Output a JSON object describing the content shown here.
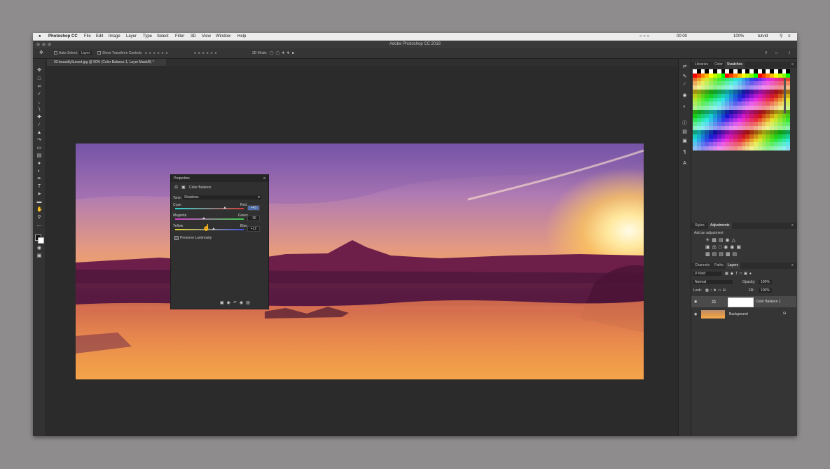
{
  "menubar": {
    "app": "Photoshop CC",
    "items": [
      "File",
      "Edit",
      "Image",
      "Layer",
      "Type",
      "Select",
      "Filter",
      "3D",
      "View",
      "Window",
      "Help"
    ],
    "status": {
      "clock": "00:00",
      "battery": "100%",
      "user": "tutvid"
    }
  },
  "window": {
    "title": "Adobe Photoshop CC 2018"
  },
  "options": {
    "auto_select": "Auto-Select:",
    "layer_select": "Layer",
    "transform": "Show Transform Controls",
    "mode3d": "3D Mode:"
  },
  "document": {
    "tab": "03-beautifySunset.jpg @ 50% (Color Balance 1, Layer Mask/8) *"
  },
  "properties": {
    "title": "Properties",
    "type_label": "Color Balance",
    "tone_label": "Tone:",
    "tone_value": "Shadows",
    "sliders": [
      {
        "left": "Cyan",
        "right": "Red",
        "value": "+43",
        "position": 0.72,
        "grad": "linear-gradient(90deg,#2fd6d6,#d83b3b)"
      },
      {
        "left": "Magenta",
        "right": "Green",
        "value": "-16",
        "position": 0.42,
        "grad": "linear-gradient(90deg,#d33fd0,#3fcf4c)"
      },
      {
        "left": "Yellow",
        "right": "Blue",
        "value": "+12",
        "position": 0.56,
        "grad": "linear-gradient(90deg,#e8d931,#3c52e6)"
      }
    ],
    "preserve": "Preserve Luminosity"
  },
  "panels": {
    "top_tabs": [
      "Libraries",
      "Color",
      "Swatches"
    ],
    "top_active": 2,
    "mid_tabs": [
      "Styles",
      "Adjustments"
    ],
    "mid_active": 1,
    "add_adjustment": "Add an adjustment",
    "bottom_tabs": [
      "Channels",
      "Paths",
      "Layers"
    ],
    "bottom_active": 2,
    "kind": "Kind",
    "blend_mode": "Normal",
    "opacity_label": "Opacity:",
    "opacity": "100%",
    "lock_label": "Lock:",
    "fill_label": "Fill:",
    "fill": "100%",
    "layers": [
      "Color Balance 1",
      "Background"
    ]
  },
  "swatch_colors": [
    "#ff0000",
    "#ff4000",
    "#ff8000",
    "#ffbf00",
    "#ffff00",
    "#c0ff00",
    "#80ff00",
    "#00ff00",
    "#00ff80",
    "#00ffff",
    "#0080ff",
    "#0000ff",
    "#8000ff",
    "#ff00ff",
    "#ff0080",
    "#ff6666",
    "#ffb366",
    "#ffff66",
    "#66ff66",
    "#66ffff",
    "#6666ff",
    "#ff66ff",
    "#cc0000",
    "#cc6600",
    "#cccc00",
    "#00cc00",
    "#00cccc",
    "#0000cc",
    "#cc00cc",
    "#990033",
    "#996633",
    "#669966",
    "#336699",
    "#663399"
  ]
}
